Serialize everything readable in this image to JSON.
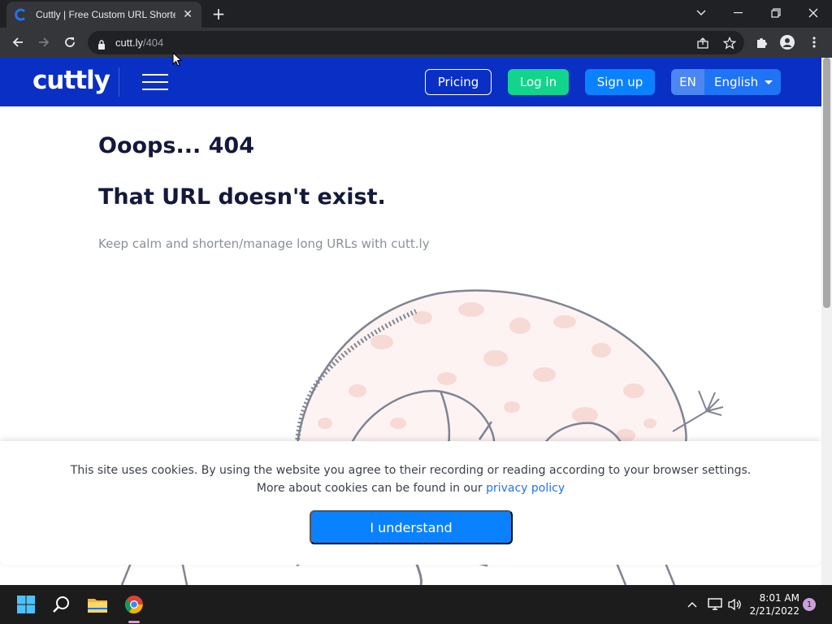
{
  "browser": {
    "tab_title": "Cuttly | Free Custom URL Shortener",
    "tab_close": "✕",
    "new_tab": "+",
    "url_host": "cutt.ly",
    "url_path": "/404"
  },
  "site": {
    "logo": "cuttly",
    "nav": {
      "pricing": "Pricing",
      "login": "Log in",
      "signup": "Sign up",
      "lang_code": "EN",
      "lang_name": "English"
    },
    "brand_colors": {
      "header": "#0a2fc4",
      "login": "#13d48c",
      "signup": "#0a82ff"
    }
  },
  "error": {
    "title": "Ooops... 404",
    "heading": "That URL doesn't exist.",
    "subtitle": "Keep calm and shorten/manage long URLs with cutt.ly"
  },
  "cookie": {
    "line1": "This site uses cookies. By using the website you agree to their recording or reading according to your browser settings.",
    "line2_prefix": "More about cookies can be found in our ",
    "link": "privacy policy",
    "button": "I understand"
  },
  "taskbar": {
    "time": "8:01 AM",
    "date": "2/21/2022",
    "notification_count": "1"
  }
}
